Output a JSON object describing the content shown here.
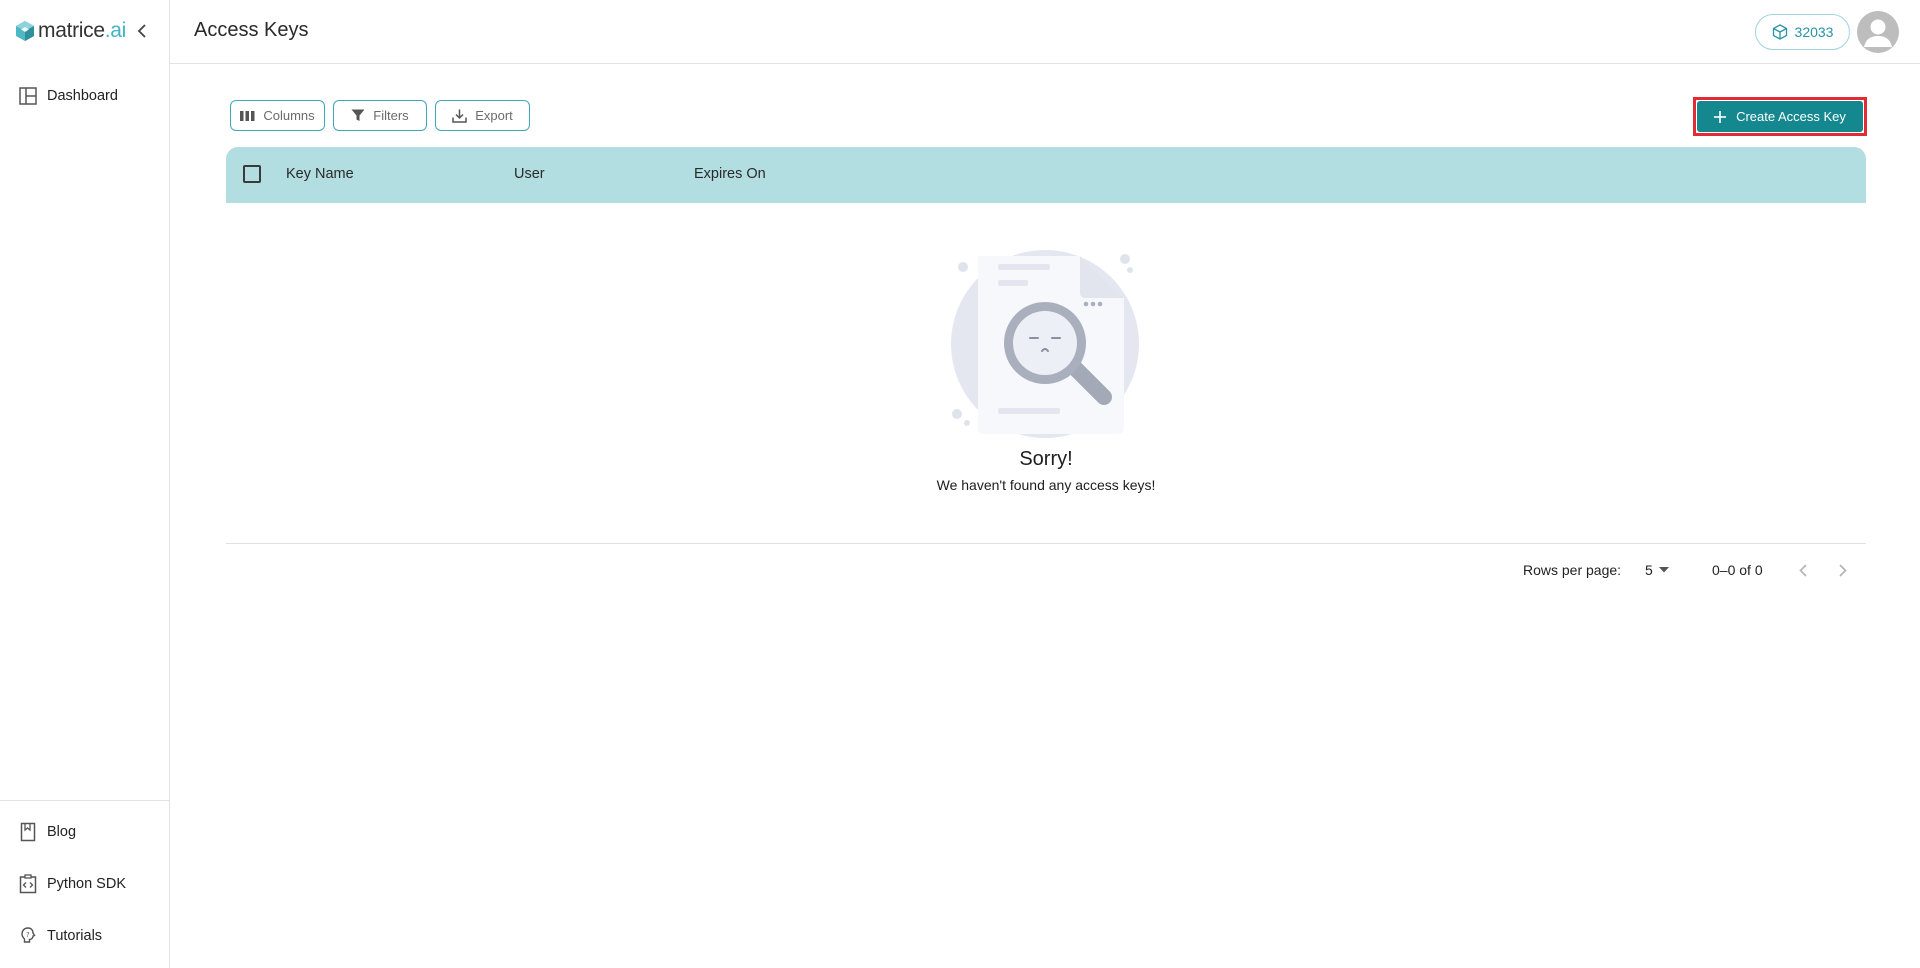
{
  "brand": {
    "name_main": "matrice",
    "name_suffix": ".ai"
  },
  "sidebar": {
    "top_items": [
      {
        "label": "Dashboard",
        "icon": "dashboard-icon"
      }
    ],
    "bottom_items": [
      {
        "label": "Blog",
        "icon": "book-icon"
      },
      {
        "label": "Python SDK",
        "icon": "code-icon"
      },
      {
        "label": "Tutorials",
        "icon": "bulb-icon"
      }
    ]
  },
  "header": {
    "title": "Access Keys",
    "credits": "32033"
  },
  "toolbar": {
    "columns_label": "Columns",
    "filters_label": "Filters",
    "export_label": "Export",
    "create_label": "Create Access Key"
  },
  "table": {
    "columns": [
      "Key Name",
      "User",
      "Expires On"
    ],
    "rows": []
  },
  "empty_state": {
    "title": "Sorry!",
    "message": "We haven't found any access keys!"
  },
  "pagination": {
    "rows_per_page_label": "Rows per page:",
    "rows_per_page": "5",
    "range": "0–0 of 0"
  },
  "colors": {
    "accent": "#14878f",
    "header_row": "#b2dde1",
    "highlight_border": "#e32b34",
    "brand_suffix": "#3fb4c4"
  }
}
